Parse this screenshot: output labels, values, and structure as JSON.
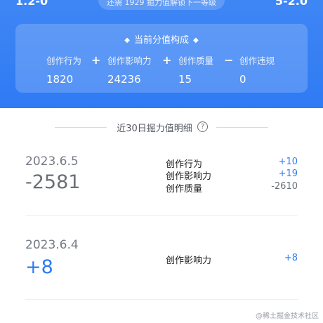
{
  "header": {
    "top_left_partial": "1.2-0",
    "top_right_partial": "5-2.0",
    "notice": "还需 1929 掘力值解锁下一等级"
  },
  "score_card": {
    "title": "当前分值构成",
    "metrics": [
      {
        "label": "创作行为",
        "value": "1820"
      },
      {
        "label": "创作影响力",
        "value": "24236"
      },
      {
        "label": "创作质量",
        "value": "15"
      },
      {
        "label": "创作违规",
        "value": "0"
      }
    ],
    "operators": [
      "+",
      "+",
      "−"
    ]
  },
  "section": {
    "title": "近30日掘力值明细"
  },
  "records": [
    {
      "date": "2023.6.5",
      "total": "-2581",
      "details": [
        {
          "label": "创作行为",
          "value": "+10"
        },
        {
          "label": "创作影响力",
          "value": "+19"
        },
        {
          "label": "创作质量",
          "value": "-2610"
        }
      ]
    },
    {
      "date": "2023.6.4",
      "total": "+8",
      "details": [
        {
          "label": "创作影响力",
          "value": "+8"
        }
      ]
    }
  ],
  "watermark": "@稀土掘金技术社区",
  "colors": {
    "header_blue": "#2f7bf4",
    "positive": "#2f7bf4",
    "negative": "#6a6f77"
  }
}
